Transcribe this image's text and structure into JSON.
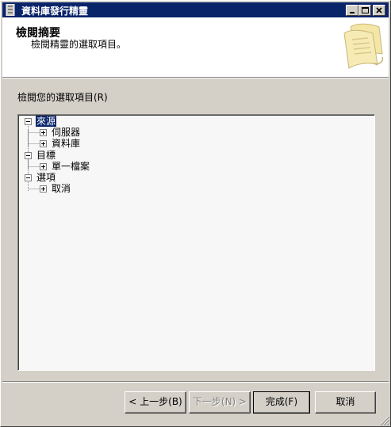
{
  "window": {
    "title": "資料庫發行精靈"
  },
  "header": {
    "title": "檢閱摘要",
    "subtitle": "檢閱精靈的選取項目。"
  },
  "content": {
    "section_label": "檢閱您的選取項目(R)",
    "tree": [
      {
        "label": "來源",
        "level": 0,
        "selected": true,
        "children": [
          {
            "label": "伺服器",
            "level": 1
          },
          {
            "label": "資料庫",
            "level": 1
          }
        ]
      },
      {
        "label": "目標",
        "level": 0,
        "children": [
          {
            "label": "單一檔案",
            "level": 1
          }
        ]
      },
      {
        "label": "選項",
        "level": 0,
        "children": [
          {
            "label": "取消",
            "level": 1
          }
        ]
      }
    ]
  },
  "buttons": {
    "back": "< 上一步(B)",
    "next": "下一步(N) >",
    "finish": "完成(F)",
    "cancel": "取消"
  },
  "colors": {
    "titlebar": "#0a246a",
    "dialog_face": "#d4d0c8",
    "selection": "#0a246a"
  }
}
